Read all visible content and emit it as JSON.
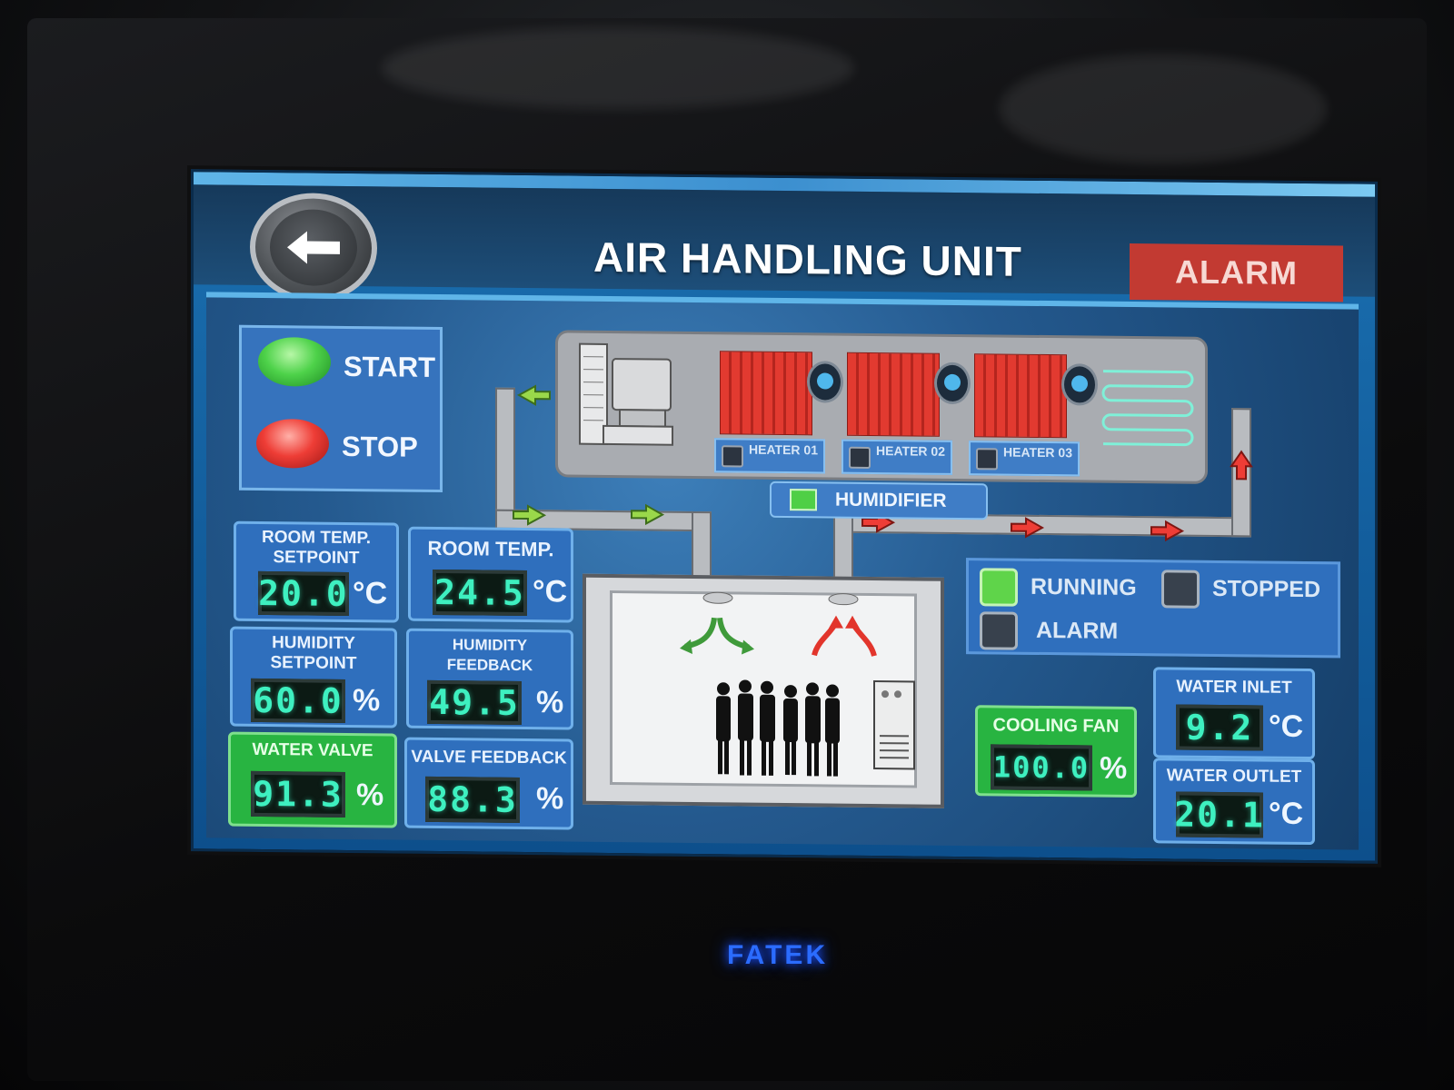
{
  "header": {
    "title": "AIR HANDLING UNIT",
    "alarm_label": "ALARM",
    "back_icon": "back-arrow-icon"
  },
  "controls": {
    "start_label": "START",
    "stop_label": "STOP"
  },
  "equipment": {
    "heaters": [
      {
        "label": "HEATER 01"
      },
      {
        "label": "HEATER 02"
      },
      {
        "label": "HEATER 03"
      }
    ],
    "humidifier": {
      "label": "HUMIDIFIER",
      "state": "on"
    }
  },
  "readouts": {
    "room_temp_setpoint": {
      "label": "ROOM TEMP. SETPOINT",
      "value": "20.0",
      "unit": "°C"
    },
    "room_temp": {
      "label": "ROOM TEMP.",
      "value": "24.5",
      "unit": "°C"
    },
    "humidity_setpoint": {
      "label": "HUMIDITY SETPOINT",
      "value": "60.0",
      "unit": "%"
    },
    "humidity_feedback": {
      "label": "HUMIDITY FEEDBACK",
      "value": "49.5",
      "unit": "%"
    },
    "water_valve": {
      "label": "WATER VALVE",
      "value": "91.3",
      "unit": "%"
    },
    "valve_feedback": {
      "label": "VALVE FEEDBACK",
      "value": "88.3",
      "unit": "%"
    },
    "cooling_fan": {
      "label": "COOLING FAN",
      "value": "100.0",
      "unit": "%"
    },
    "water_inlet": {
      "label": "WATER INLET",
      "value": "9.2",
      "unit": "°C"
    },
    "water_outlet": {
      "label": "WATER OUTLET",
      "value": "20.1",
      "unit": "°C"
    }
  },
  "status": {
    "running_label": "RUNNING",
    "stopped_label": "STOPPED",
    "alarm_label": "ALARM"
  },
  "colors": {
    "screen_blue": "#1a6fb0",
    "panel_blue": "#2f6fbd",
    "lcd_text": "#3ef0c0",
    "alarm_red": "#c23a32",
    "running_green": "#5fd44a"
  },
  "device": {
    "brand": "FATEK"
  }
}
